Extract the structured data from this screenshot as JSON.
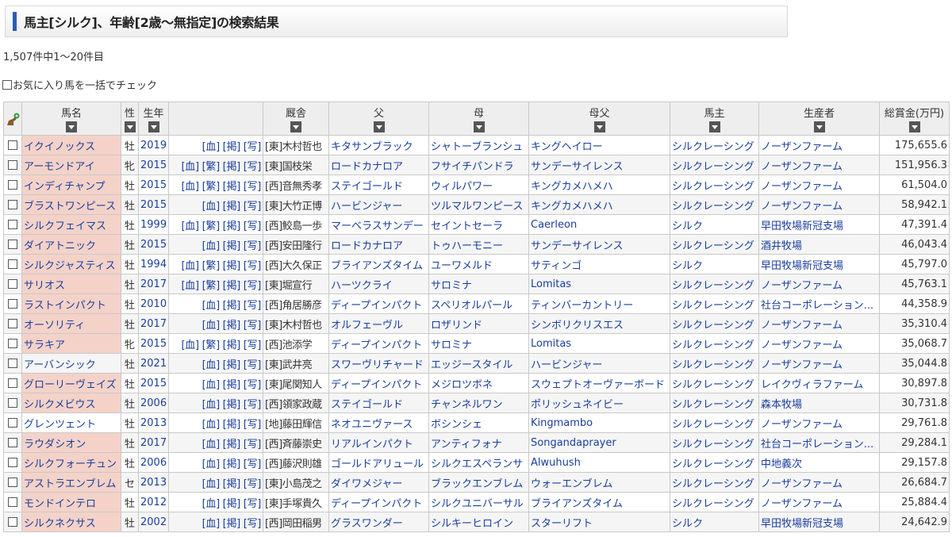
{
  "page_title": "馬主[シルク]、年齢[2歳～無指定]の検索結果",
  "result_count": "1,507件中1～20件目",
  "fav_check_label": "お気に入り馬を一括でチェック",
  "columns": {
    "name": "馬名",
    "sex": "性",
    "year": "生年",
    "trainer": "厩舎",
    "sire": "父",
    "dam": "母",
    "damsire": "母父",
    "owner": "馬主",
    "breeder": "生産者",
    "prize": "総賞金(万円)"
  },
  "rows": [
    {
      "name": "イクイノックス",
      "sex": "牡",
      "year": "2019",
      "links": "[血] [掲] [写]",
      "trainer": "[東]木村哲也",
      "sire": "キタサンブラック",
      "dam": "シャトーブランシュ",
      "damsire": "キングヘイロー",
      "owner": "シルクレーシング",
      "breeder": "ノーザンファーム",
      "prize": "175,655.6",
      "hl": true
    },
    {
      "name": "アーモンドアイ",
      "sex": "牝",
      "year": "2015",
      "links": "[血] [繁] [掲] [写]",
      "trainer": "[東]国枝栄",
      "sire": "ロードカナロア",
      "dam": "フサイチパンドラ",
      "damsire": "サンデーサイレンス",
      "owner": "シルクレーシング",
      "breeder": "ノーザンファーム",
      "prize": "151,956.3",
      "hl": true
    },
    {
      "name": "インディチャンプ",
      "sex": "牡",
      "year": "2015",
      "links": "[血] [繁] [掲] [写]",
      "trainer": "[西]音無秀孝",
      "sire": "ステイゴールド",
      "dam": "ウィルパワー",
      "damsire": "キングカメハメハ",
      "owner": "シルクレーシング",
      "breeder": "ノーザンファーム",
      "prize": "61,504.0",
      "hl": true
    },
    {
      "name": "ブラストワンピース",
      "sex": "牡",
      "year": "2015",
      "links": "[血] [掲] [写]",
      "trainer": "[東]大竹正博",
      "sire": "ハービンジャー",
      "dam": "ツルマルワンピース",
      "damsire": "キングカメハメハ",
      "owner": "シルクレーシング",
      "breeder": "ノーザンファーム",
      "prize": "58,942.1",
      "hl": true
    },
    {
      "name": "シルクフェイマス",
      "sex": "牡",
      "year": "1999",
      "links": "[血] [繁] [掲] [写]",
      "trainer": "[西]鮫島一歩",
      "sire": "マーベラスサンデー",
      "dam": "セイントセーラ",
      "damsire": "Caerleon",
      "owner": "シルク",
      "breeder": "早田牧場新冠支場",
      "prize": "47,391.4",
      "hl": true
    },
    {
      "name": "ダイアトニック",
      "sex": "牡",
      "year": "2015",
      "links": "[血] [掲] [写]",
      "trainer": "[西]安田隆行",
      "sire": "ロードカナロア",
      "dam": "トゥハーモニー",
      "damsire": "サンデーサイレンス",
      "owner": "シルクレーシング",
      "breeder": "酒井牧場",
      "prize": "46,043.4",
      "hl": true
    },
    {
      "name": "シルクジャスティス",
      "sex": "牡",
      "year": "1994",
      "links": "[血] [繁] [掲] [写]",
      "trainer": "[西]大久保正",
      "sire": "ブライアンズタイム",
      "dam": "ユーワメルド",
      "damsire": "サティンゴ",
      "owner": "シルク",
      "breeder": "早田牧場新冠支場",
      "prize": "45,797.0",
      "hl": true
    },
    {
      "name": "サリオス",
      "sex": "牡",
      "year": "2017",
      "links": "[血] [繁] [掲] [写]",
      "trainer": "[東]堀宣行",
      "sire": "ハーツクライ",
      "dam": "サロミナ",
      "damsire": "Lomitas",
      "owner": "シルクレーシング",
      "breeder": "ノーザンファーム",
      "prize": "45,763.1",
      "hl": true
    },
    {
      "name": "ラストインパクト",
      "sex": "牡",
      "year": "2010",
      "links": "[血] [掲] [写]",
      "trainer": "[西]角居勝彦",
      "sire": "ディープインパクト",
      "dam": "スペリオルパール",
      "damsire": "ティンバーカントリー",
      "owner": "シルクレーシング",
      "breeder": "社台コーポレーション...",
      "prize": "44,358.9",
      "hl": true
    },
    {
      "name": "オーソリティ",
      "sex": "牡",
      "year": "2017",
      "links": "[血] [掲] [写]",
      "trainer": "[東]木村哲也",
      "sire": "オルフェーヴル",
      "dam": "ロザリンド",
      "damsire": "シンボリクリスエス",
      "owner": "シルクレーシング",
      "breeder": "ノーザンファーム",
      "prize": "35,310.4",
      "hl": true
    },
    {
      "name": "サラキア",
      "sex": "牝",
      "year": "2015",
      "links": "[血] [繁] [掲] [写]",
      "trainer": "[西]池添学",
      "sire": "ディープインパクト",
      "dam": "サロミナ",
      "damsire": "Lomitas",
      "owner": "シルクレーシング",
      "breeder": "ノーザンファーム",
      "prize": "35,068.7",
      "hl": true
    },
    {
      "name": "アーバンシック",
      "sex": "牡",
      "year": "2021",
      "links": "[血] [掲] [写]",
      "trainer": "[東]武井亮",
      "sire": "スワーヴリチャード",
      "dam": "エッジースタイル",
      "damsire": "ハービンジャー",
      "owner": "シルクレーシング",
      "breeder": "ノーザンファーム",
      "prize": "35,044.8",
      "hl": false
    },
    {
      "name": "グローリーヴェイズ",
      "sex": "牡",
      "year": "2015",
      "links": "[血] [掲] [写]",
      "trainer": "[東]尾関知人",
      "sire": "ディープインパクト",
      "dam": "メジロツボネ",
      "damsire": "スウェプトオーヴァーボード",
      "owner": "シルクレーシング",
      "breeder": "レイクヴィラファーム",
      "prize": "30,897.8",
      "hl": true
    },
    {
      "name": "シルクメビウス",
      "sex": "牡",
      "year": "2006",
      "links": "[血] [掲] [写]",
      "trainer": "[西]領家政蔵",
      "sire": "ステイゴールド",
      "dam": "チャンネルワン",
      "damsire": "ポリッシュネイビー",
      "owner": "シルクレーシング",
      "breeder": "森本牧場",
      "prize": "30,731.8",
      "hl": true
    },
    {
      "name": "グレンツェント",
      "sex": "牡",
      "year": "2013",
      "links": "[血] [掲] [写]",
      "trainer": "[地]藤田輝信",
      "sire": "ネオユニヴァース",
      "dam": "ボシンシェ",
      "damsire": "Kingmambo",
      "owner": "シルクレーシング",
      "breeder": "ノーザンファーム",
      "prize": "29,761.8",
      "hl": false
    },
    {
      "name": "ラウダシオン",
      "sex": "牡",
      "year": "2017",
      "links": "[血] [掲] [写]",
      "trainer": "[西]斉藤崇史",
      "sire": "リアルインパクト",
      "dam": "アンティフォナ",
      "damsire": "Songandaprayer",
      "owner": "シルクレーシング",
      "breeder": "社台コーポレーション...",
      "prize": "29,284.1",
      "hl": true
    },
    {
      "name": "シルクフォーチュン",
      "sex": "牡",
      "year": "2006",
      "links": "[血] [掲] [写]",
      "trainer": "[西]藤沢則雄",
      "sire": "ゴールドアリュール",
      "dam": "シルクエスペランサ",
      "damsire": "Alwuhush",
      "owner": "シルクレーシング",
      "breeder": "中地義次",
      "prize": "29,157.8",
      "hl": true
    },
    {
      "name": "アストラエンブレム",
      "sex": "セ",
      "year": "2013",
      "links": "[血] [掲] [写]",
      "trainer": "[東]小島茂之",
      "sire": "ダイワメジャー",
      "dam": "ブラックエンブレム",
      "damsire": "ウォーエンブレム",
      "owner": "シルクレーシング",
      "breeder": "ノーザンファーム",
      "prize": "26,684.7",
      "hl": true
    },
    {
      "name": "モンドインテロ",
      "sex": "牡",
      "year": "2012",
      "links": "[血] [掲] [写]",
      "trainer": "[東]手塚貴久",
      "sire": "ディープインパクト",
      "dam": "シルクユニバーサル",
      "damsire": "ブライアンズタイム",
      "owner": "シルクレーシング",
      "breeder": "ノーザンファーム",
      "prize": "25,884.4",
      "hl": true
    },
    {
      "name": "シルクネクサス",
      "sex": "牡",
      "year": "2002",
      "links": "[血] [掲] [写]",
      "trainer": "[西]岡田稲男",
      "sire": "グラスワンダー",
      "dam": "シルキーヒロイン",
      "damsire": "スターリフト",
      "owner": "シルク",
      "breeder": "早田牧場新冠支場",
      "prize": "24,642.9",
      "hl": true
    }
  ]
}
